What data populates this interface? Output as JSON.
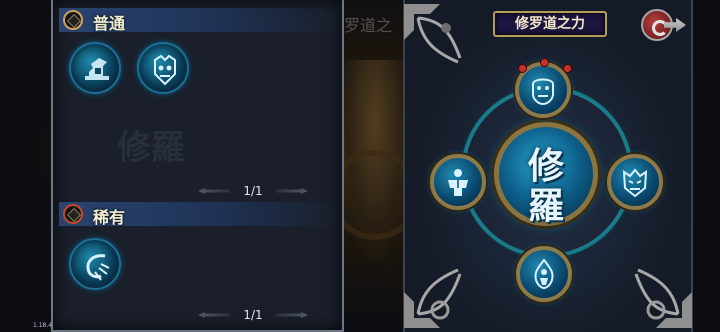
{
  "left_panel": {
    "common": {
      "title": "普通",
      "items": [
        "tower-skill-icon",
        "demon-face-skill-icon"
      ],
      "pager": "1/1",
      "watermark": "修羅"
    },
    "rare": {
      "title": "稀有",
      "items": [
        "claw-skill-icon"
      ],
      "pager": "1/1"
    }
  },
  "right_panel": {
    "title": "修罗道之力",
    "header_echo": "罗道之",
    "center_glyph_top": "修",
    "center_glyph_bottom": "羅",
    "satellites": [
      "mask-skill-icon",
      "muscle-body-skill-icon",
      "oni-face-skill-icon",
      "flame-figure-skill-icon"
    ]
  },
  "version": "1.18.4",
  "colors": {
    "orb_blue": "#1f88a8",
    "frame_gold": "#b39b58",
    "title_bg": "#1c1540",
    "accent_red": "#c8302a"
  }
}
